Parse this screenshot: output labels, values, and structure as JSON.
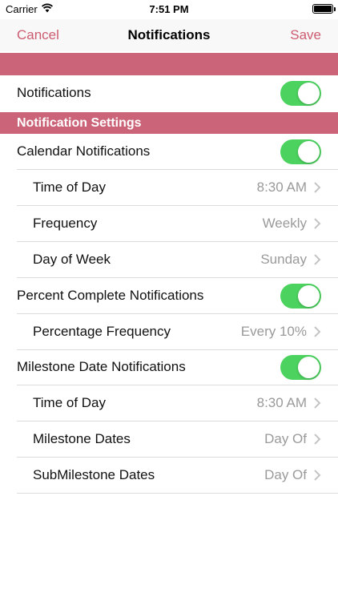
{
  "status_bar": {
    "carrier": "Carrier",
    "time": "7:51 PM"
  },
  "nav": {
    "cancel": "Cancel",
    "title": "Notifications",
    "save": "Save"
  },
  "colors": {
    "accent": "#cc5c70",
    "band": "#cc6479",
    "toggle_on": "#4cd35f"
  },
  "main_toggle": {
    "label": "Notifications",
    "on": true
  },
  "section_header": "Notification Settings",
  "calendar": {
    "label": "Calendar Notifications",
    "on": true,
    "time_of_day": {
      "label": "Time of Day",
      "value": "8:30 AM"
    },
    "frequency": {
      "label": "Frequency",
      "value": "Weekly"
    },
    "day_of_week": {
      "label": "Day of Week",
      "value": "Sunday"
    }
  },
  "percent": {
    "label": "Percent Complete Notifications",
    "on": true,
    "frequency": {
      "label": "Percentage Frequency",
      "value": "Every 10%"
    }
  },
  "milestone": {
    "label": "Milestone Date Notifications",
    "on": true,
    "time_of_day": {
      "label": "Time of Day",
      "value": "8:30 AM"
    },
    "milestone_dates": {
      "label": "Milestone Dates",
      "value": "Day Of"
    },
    "submilestone_dates": {
      "label": "SubMilestone Dates",
      "value": "Day Of"
    }
  }
}
